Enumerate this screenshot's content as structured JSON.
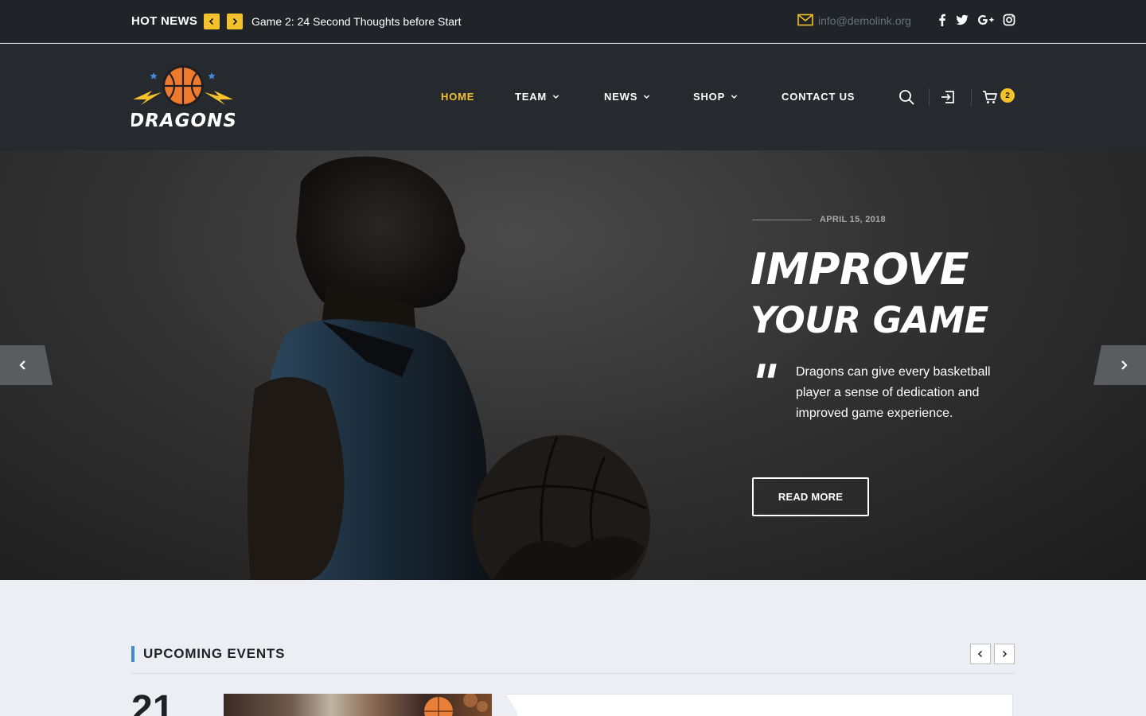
{
  "topbar": {
    "hot_label": "HOT NEWS",
    "headline": "Game 2: 24 Second Thoughts before Start",
    "email": "info@demolink.org",
    "social_icons": [
      "facebook-icon",
      "twitter-icon",
      "google-plus-icon",
      "instagram-icon"
    ]
  },
  "header": {
    "logo_text": "DRAGONS",
    "nav": [
      {
        "label": "HOME",
        "active": true,
        "dropdown": false
      },
      {
        "label": "TEAM",
        "active": false,
        "dropdown": true
      },
      {
        "label": "NEWS",
        "active": false,
        "dropdown": true
      },
      {
        "label": "SHOP",
        "active": false,
        "dropdown": true
      },
      {
        "label": "CONTACT US",
        "active": false,
        "dropdown": false
      }
    ],
    "cart_count": "2"
  },
  "hero": {
    "date": "APRIL 15, 2018",
    "title_line1": "IMPROVE",
    "title_line2": "YOUR GAME",
    "quote_mark": "\"",
    "description": "Dragons can give every basketball player a sense of dedication and improved game experience.",
    "button_label": "READ MORE"
  },
  "events": {
    "title": "UPCOMING EVENTS",
    "first_day": "21"
  },
  "colors": {
    "accent": "#f3c12a",
    "topbar_bg": "#202428",
    "header_bg": "#262a2e",
    "section_bg": "#eceef3",
    "events_marker": "#3f8ad9"
  }
}
